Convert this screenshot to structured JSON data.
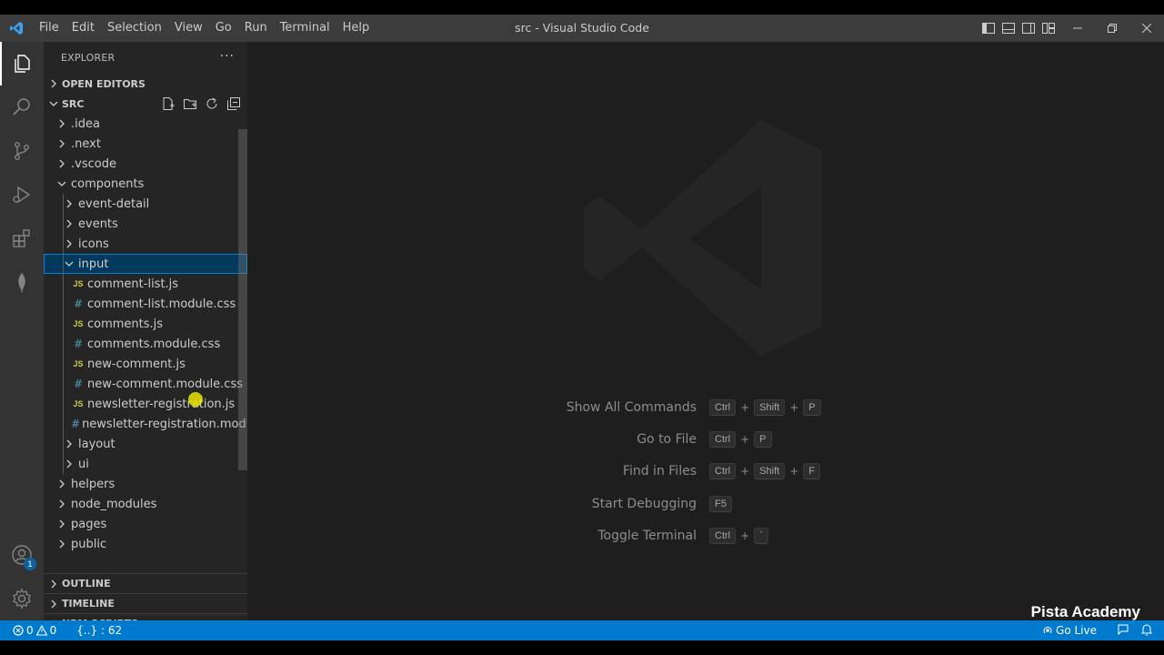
{
  "window": {
    "title": "src - Visual Studio Code"
  },
  "menu": [
    "File",
    "Edit",
    "Selection",
    "View",
    "Go",
    "Run",
    "Terminal",
    "Help"
  ],
  "activity_bar": {
    "icons": [
      "explorer-icon",
      "search-icon",
      "source-control-icon",
      "run-debug-icon",
      "extensions-icon",
      "mongodb-icon",
      "accounts-icon",
      "manage-gear-icon"
    ],
    "accounts_badge": "1"
  },
  "sidebar": {
    "header": "EXPLORER",
    "more": "···",
    "open_editors": "OPEN EDITORS",
    "root": "SRC",
    "tree": [
      {
        "label": ".idea",
        "type": "folder",
        "depth": 1,
        "open": false
      },
      {
        "label": ".next",
        "type": "folder",
        "depth": 1,
        "open": false
      },
      {
        "label": ".vscode",
        "type": "folder",
        "depth": 1,
        "open": false
      },
      {
        "label": "components",
        "type": "folder",
        "depth": 1,
        "open": true
      },
      {
        "label": "event-detail",
        "type": "folder",
        "depth": 2,
        "open": false
      },
      {
        "label": "events",
        "type": "folder",
        "depth": 2,
        "open": false
      },
      {
        "label": "icons",
        "type": "folder",
        "depth": 2,
        "open": false
      },
      {
        "label": "input",
        "type": "folder",
        "depth": 2,
        "open": true,
        "selected": true
      },
      {
        "label": "comment-list.js",
        "type": "js",
        "depth": 3
      },
      {
        "label": "comment-list.module.css",
        "type": "css",
        "depth": 3
      },
      {
        "label": "comments.js",
        "type": "js",
        "depth": 3
      },
      {
        "label": "comments.module.css",
        "type": "css",
        "depth": 3
      },
      {
        "label": "new-comment.js",
        "type": "js",
        "depth": 3
      },
      {
        "label": "new-comment.module.css",
        "type": "css",
        "depth": 3
      },
      {
        "label": "newsletter-registration.js",
        "type": "js",
        "depth": 3
      },
      {
        "label": "newsletter-registration.mod...",
        "type": "css",
        "depth": 3
      },
      {
        "label": "layout",
        "type": "folder",
        "depth": 2,
        "open": false
      },
      {
        "label": "ui",
        "type": "folder",
        "depth": 2,
        "open": false
      },
      {
        "label": "helpers",
        "type": "folder",
        "depth": 1,
        "open": false
      },
      {
        "label": "node_modules",
        "type": "folder",
        "depth": 1,
        "open": false
      },
      {
        "label": "pages",
        "type": "folder",
        "depth": 1,
        "open": false
      },
      {
        "label": "public",
        "type": "folder",
        "depth": 1,
        "open": false
      }
    ],
    "bottom_sections": [
      "OUTLINE",
      "TIMELINE",
      "NPM SCRIPTS"
    ]
  },
  "editor": {
    "shortcuts": [
      {
        "label": "Show All Commands",
        "keys": [
          "Ctrl",
          "Shift",
          "P"
        ]
      },
      {
        "label": "Go to File",
        "keys": [
          "Ctrl",
          "P"
        ]
      },
      {
        "label": "Find in Files",
        "keys": [
          "Ctrl",
          "Shift",
          "F"
        ]
      },
      {
        "label": "Start Debugging",
        "keys": [
          "F5"
        ]
      },
      {
        "label": "Toggle Terminal",
        "keys": [
          "Ctrl",
          "`"
        ]
      }
    ]
  },
  "statusbar": {
    "errors": "0",
    "warnings": "0",
    "position": "{..} : 62",
    "go_live": "Go Live"
  },
  "brand": "Pista Academy",
  "colors": {
    "accent": "#007acc",
    "selection": "#04395e",
    "js": "#cbcb41",
    "css": "#519aba"
  }
}
